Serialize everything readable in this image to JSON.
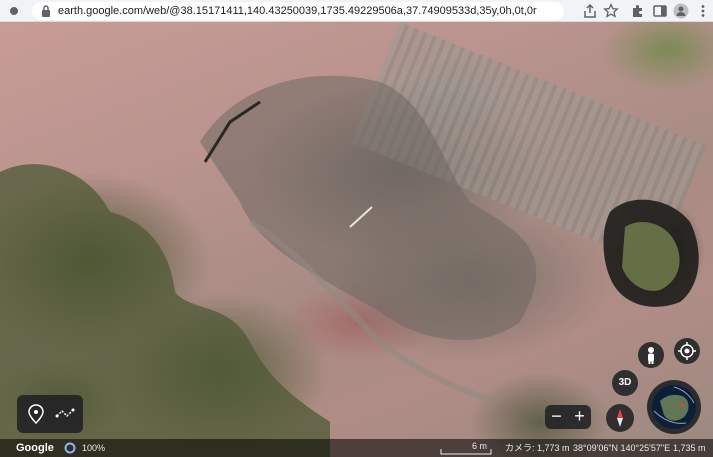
{
  "browser": {
    "url": "earth.google.com/web/@38.15171411,140.43250039,1735.49229506a,37.74909533d,35y,0h,0t,0r"
  },
  "map": {
    "controls": {
      "three_d_label": "3D",
      "zoom_out": "−",
      "zoom_in": "+"
    },
    "footer": {
      "logo": "Google",
      "load_percent": "100%",
      "scale": "6 m",
      "camera": "カメラ: 1,773 m",
      "coordinates": "38°09'06\"N 140°25'57\"E",
      "elevation": "1,735 m"
    }
  },
  "colors": {
    "panel": "#202124",
    "ring": "#8ab4f8",
    "compass_red": "#ea4335"
  }
}
